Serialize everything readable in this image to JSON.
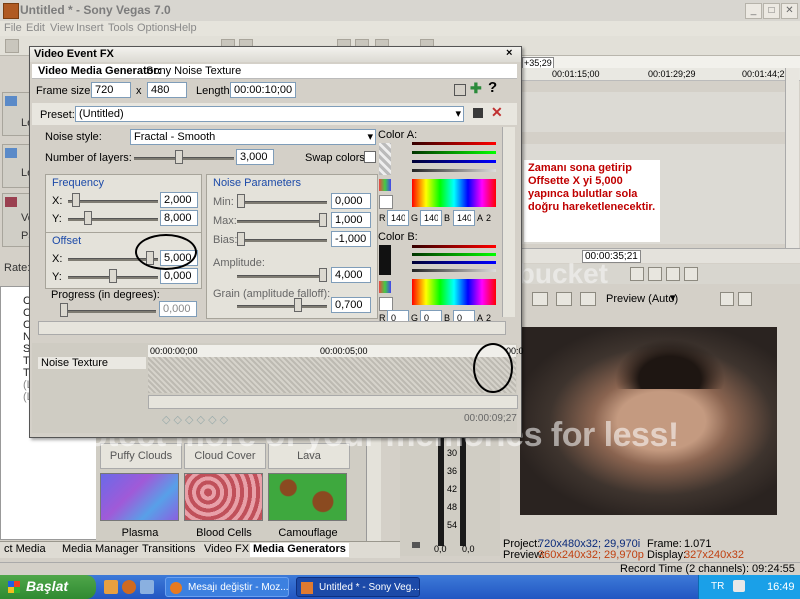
{
  "app": {
    "title": "Untitled * - Sony Vegas 7.0",
    "menu": [
      "File",
      "Edit",
      "View",
      "Insert",
      "Tools",
      "Options",
      "Help"
    ]
  },
  "timeline": {
    "cursor_badge": "+35;29",
    "ruler_ticks": [
      "00:01:15;00",
      "00:01:29;29",
      "00:01:44;29"
    ],
    "position": "00:00:35;21",
    "track_labels": [
      "Lev",
      "Lev",
      "Vo",
      "Pa"
    ]
  },
  "annotation_text": "Zamanı sona getirip Offsette X yi 5,000 yapınca bulutlar sola doğru hareketlenecektir.",
  "fx": {
    "window_title": "Video Event FX",
    "generator_label": "Video Media Generator:",
    "generator_name": "Sony Noise Texture",
    "frame_size_label": "Frame size:",
    "frame_w": "720",
    "frame_x": "x",
    "frame_h": "480",
    "length_label": "Length:",
    "length": "00:00:10;00",
    "preset_label": "Preset:",
    "preset_value": "(Untitled)",
    "noise_style_label": "Noise style:",
    "noise_style": "Fractal - Smooth",
    "layers_label": "Number of layers:",
    "layers_value": "3,000",
    "layers_level": 0.45,
    "swap_colors": "Swap colors",
    "frequency": {
      "title": "Frequency",
      "x_label": "X:",
      "x_value": "2,000",
      "x_level": 0.05,
      "y_label": "Y:",
      "y_value": "8,000",
      "y_level": 0.2
    },
    "offset": {
      "title": "Offset",
      "x_label": "X:",
      "x_value": "5,000",
      "x_level": 0.95,
      "y_label": "Y:",
      "y_value": "0,000",
      "y_level": 0.5
    },
    "progress": {
      "label": "Progress (in degrees):",
      "value": "0,000",
      "level": 0.0
    },
    "noise_params": {
      "title": "Noise Parameters",
      "min_label": "Min:",
      "min_value": "0,000",
      "min_level": 0.0,
      "max_label": "Max:",
      "max_value": "1,000",
      "max_level": 1.0,
      "bias_label": "Bias:",
      "bias_value": "-1,000",
      "bias_level": 0.0,
      "amp_label": "Amplitude:",
      "amp_value": "4,000",
      "amp_level": 1.0,
      "grain_label": "Grain (amplitude falloff):",
      "grain_value": "0,700",
      "grain_level": 0.7
    },
    "color_a": {
      "label": "Color A:",
      "r_label": "R",
      "r": "140",
      "g_label": "G",
      "g": "140",
      "b_label": "B",
      "b": "140",
      "a_label": "A",
      "a": "2"
    },
    "color_b": {
      "label": "Color B:",
      "r_label": "R",
      "r": "0",
      "g_label": "G",
      "g": "0",
      "b_label": "B",
      "b": "0",
      "a_label": "A",
      "a": "2"
    },
    "keyframe": {
      "track_name": "Noise Texture",
      "t0": "00:00:00;00",
      "t1": "00:00:05;00",
      "t2": "00:0",
      "end_time": "00:00:09;27"
    }
  },
  "gallery": {
    "row1": [
      "Puffy Clouds",
      "Cloud Cover",
      "Lava"
    ],
    "row2": [
      "Plasma",
      "Blood Cells",
      "Camouflage"
    ]
  },
  "meter": {
    "ticks": [
      "30",
      "36",
      "42",
      "48",
      "54"
    ],
    "left": "0,0",
    "right": "0,0"
  },
  "left_panel": [
    "Co",
    "Co",
    "Cr",
    "Nu",
    "So",
    "Te",
    "Te",
    "(L",
    "(L"
  ],
  "rate_label": "Rate: 0",
  "tabs": [
    "ct Media",
    "Media Manager",
    "Transitions",
    "Video FX",
    "Media Generators"
  ],
  "preview": {
    "mode": "Preview (Auto)",
    "project_label": "Project:",
    "project_value": "720x480x32; 29,970i",
    "preview_label": "Preview:",
    "preview_value": "360x240x32; 29,970p",
    "frame_label": "Frame:",
    "frame_value": "1.071",
    "display_label": "Display:",
    "display_value": "327x240x32"
  },
  "record_time": "Record Time (2 channels): 09:24:55",
  "watermark": {
    "line1": "Protect more of your memories for less!",
    "brand": "photobucket"
  },
  "taskbar": {
    "start": "Başlat",
    "task1": "Mesajı değiştir - Moz...",
    "task2": "Untitled * - Sony Veg...",
    "lang": "TR",
    "clock": "16:49"
  },
  "colors": {
    "annotation": "#c00000",
    "taskbar": "#2256c2",
    "start": "#3a9a3a"
  }
}
